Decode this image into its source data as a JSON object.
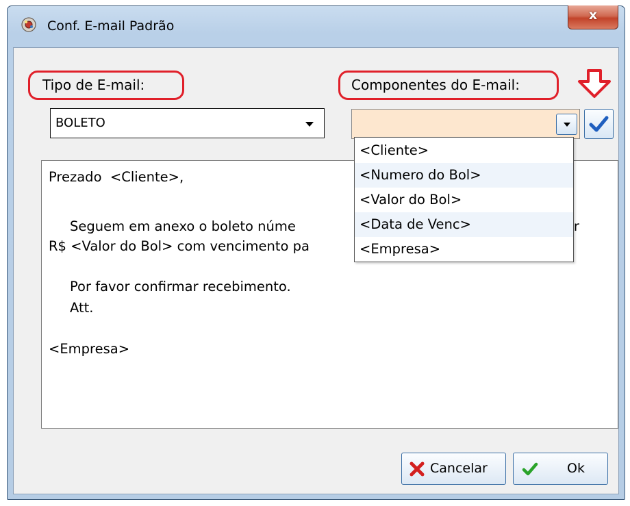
{
  "window": {
    "title": "Conf. E-mail Padrão",
    "close_label": "x"
  },
  "form": {
    "tipo_label": "Tipo de E-mail:",
    "tipo_value": "BOLETO",
    "componentes_label": "Componentes do E-mail:",
    "componentes_value": ""
  },
  "memo": {
    "lines": [
      "Prezado  <Cliente>,",
      "",
      "     Seguem em anexo o boleto núme",
      "or",
      "R$ <Valor do Bol> com vencimento pa",
      "",
      "     Por favor confirmar recebimento.",
      "     Att.",
      "",
      "<Empresa>"
    ]
  },
  "dropdown": {
    "items": [
      "<Cliente>",
      "<Numero do Bol>",
      "<Valor do Bol>",
      "<Data de Venc>",
      "<Empresa>"
    ]
  },
  "buttons": {
    "cancel_label": "Cancelar",
    "ok_label": "Ok"
  },
  "colors": {
    "highlight": "#e0202a",
    "combo_bg": "#fde7cf",
    "check": "#1f5fbf",
    "cancel_x": "#d32020",
    "ok_check": "#2aa32a"
  }
}
